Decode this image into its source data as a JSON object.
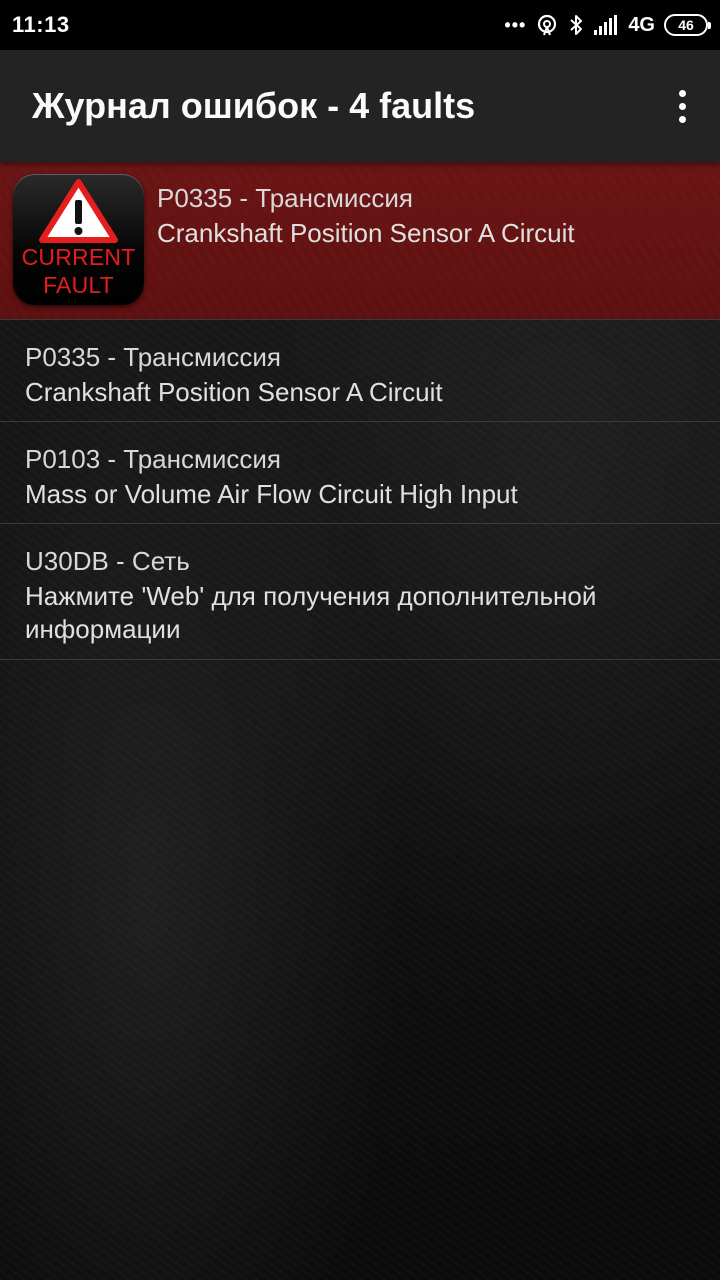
{
  "status_bar": {
    "time": "11:13",
    "dots": "•••",
    "network": "4G",
    "battery": "46",
    "icons": [
      "hotspot-icon",
      "bluetooth-icon",
      "signal-icon"
    ]
  },
  "app_bar": {
    "title": "Журнал ошибок - 4 faults",
    "overflow_icon": "more-vert-icon"
  },
  "current_fault": {
    "badge_line1": "CURRENT",
    "badge_line2": "FAULT",
    "badge_icon": "warning-triangle-icon",
    "code": "P0335 - Трансмиссия",
    "description": "Crankshaft Position Sensor A Circuit",
    "highlight_color": "#6b1414"
  },
  "faults": [
    {
      "code": "P0335 - Трансмиссия",
      "description": "Crankshaft Position Sensor A Circuit"
    },
    {
      "code": "P0103 - Трансмиссия",
      "description": "Mass or Volume Air Flow Circuit High Input"
    },
    {
      "code": "U30DB - Сеть",
      "description": "Нажмите 'Web' для получения дополнительной информации"
    }
  ]
}
